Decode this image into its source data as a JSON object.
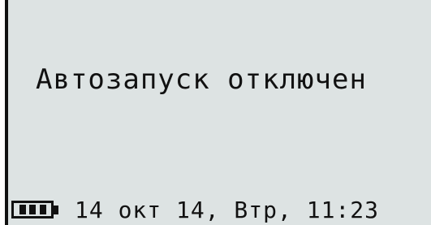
{
  "screen": {
    "message": "Автозапуск отключен"
  },
  "status_bar": {
    "battery_icon": "battery-full-icon",
    "datetime": "14 окт 14, Втр, 11:23"
  },
  "colors": {
    "background": "#dde3e3",
    "foreground": "#111111"
  }
}
